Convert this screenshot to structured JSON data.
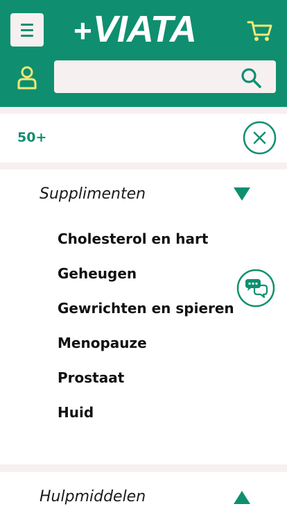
{
  "header": {
    "logo_text": "+VIATA",
    "menu_icon": "hamburger-menu-icon",
    "cart_icon": "shopping-cart-icon",
    "user_icon": "user-account-icon",
    "search_icon": "search-icon",
    "search_value": "",
    "search_placeholder": ""
  },
  "filter": {
    "label": "50+",
    "close_icon": "close-circle-icon"
  },
  "sections": [
    {
      "title": "Supplimenten",
      "expanded": true,
      "toggle_icon": "triangle-down-icon",
      "items": [
        "Cholesterol en hart",
        "Geheugen",
        "Gewrichten en spieren",
        "Menopauze",
        "Prostaat",
        "Huid"
      ]
    },
    {
      "title": "Hulpmiddelen",
      "expanded": false,
      "toggle_icon": "triangle-up-icon"
    }
  ],
  "chat_icon": "chat-bubbles-icon",
  "colors": {
    "brand_green": "#0f8f6f",
    "accent_yellow": "#f0e87a",
    "light_band": "#f7f0f0",
    "text_dark": "#111111"
  }
}
